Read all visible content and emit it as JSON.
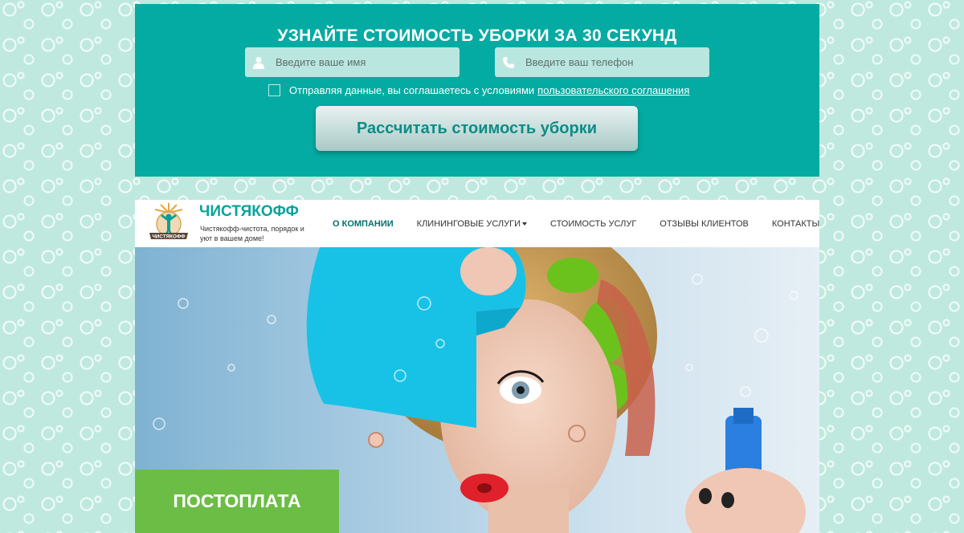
{
  "form": {
    "title": "УЗНАЙТЕ СТОИМОСТЬ УБОРКИ ЗА 30 СЕКУНД",
    "name_placeholder": "Введите ваше имя",
    "phone_placeholder": "Введите ваш телефон",
    "consent_text": "Отправляя данные, вы соглашаетесь с условиями",
    "consent_link": "пользовательского соглашения",
    "submit_label": "Рассчитать стоимость уборки",
    "consent_checked": false
  },
  "header": {
    "logo_text": "ЧИСТЯКОФФ",
    "brand_name": "ЧИСТЯКОФФ",
    "slogan": "Чистякофф-чистота, порядок и уют в вашем доме!"
  },
  "nav": {
    "items": [
      {
        "label": "О КОМПАНИИ",
        "active": true
      },
      {
        "label": "КЛИНИНГОВЫЕ УСЛУГИ",
        "active": false,
        "dropdown": true
      },
      {
        "label": "СТОИМОСТЬ УСЛУГ",
        "active": false
      },
      {
        "label": "ОТЗЫВЫ КЛИЕНТОВ",
        "active": false
      },
      {
        "label": "КОНТАКТЫ",
        "active": false
      }
    ]
  },
  "hero": {
    "badge": "ПОСТОПЛАТА"
  },
  "colors": {
    "teal": "#04aba2",
    "brand": "#0aa39b",
    "badge_green": "#6cbd45",
    "field_bg": "#b9e7df"
  },
  "icons": {
    "name_field": "user-icon",
    "phone_field": "phone-icon",
    "nav_dropdown": "caret-down-icon"
  }
}
